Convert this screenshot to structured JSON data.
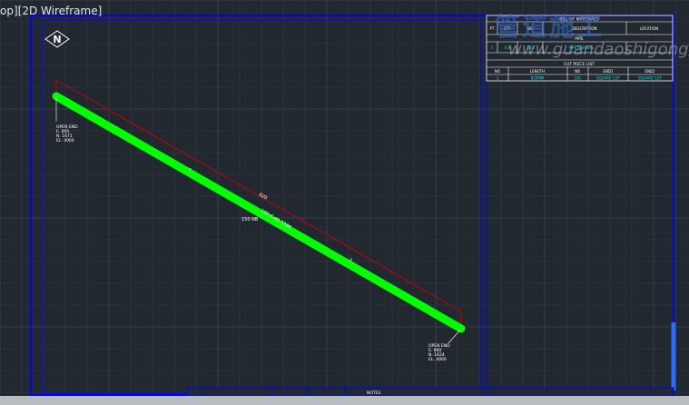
{
  "viewport": {
    "label": "op][2D Wireframe]"
  },
  "watermark": {
    "text": "管道施工",
    "url": "www.guandaoshigong.net",
    "color": "#3c6ed2"
  },
  "colors": {
    "background": "#212830",
    "border": "#0000ff",
    "pipe": "#00ff00",
    "dimension": "#cc0000",
    "text": "#ffffff",
    "table_text": "#00e6e6"
  },
  "north_symbol": {
    "letter": "N"
  },
  "pipe": {
    "start_label": [
      "OPEN END",
      "E. 805",
      "N. 1671",
      "EL. 4000"
    ],
    "end_label": [
      "OPEN END",
      "E. 860",
      "N. 1624",
      "EL. 4000"
    ],
    "dimension_length": "820",
    "spec_label": "150-C-40-1234",
    "size_label": "150 NB",
    "elbow_tags": [
      "1",
      "2"
    ]
  },
  "bom_table": {
    "title": "BILL OF MATERIALS",
    "headers": [
      "PT",
      "QTY",
      "NO",
      "DESCRIPTION",
      "LOCATION"
    ],
    "section": "PIPE",
    "row": [
      "1",
      "0.8",
      "150",
      "PIPE SCH 10S",
      ""
    ]
  },
  "cut_table": {
    "title": "CUT PIECE LIST",
    "headers": [
      "NO",
      "LENGTH",
      "NB",
      "END1",
      "END2"
    ],
    "row": [
      "1",
      "820MM",
      "150",
      "SQUARE CUT",
      "SQUARE CUT"
    ]
  },
  "title_block": {
    "label": "NOTES"
  }
}
